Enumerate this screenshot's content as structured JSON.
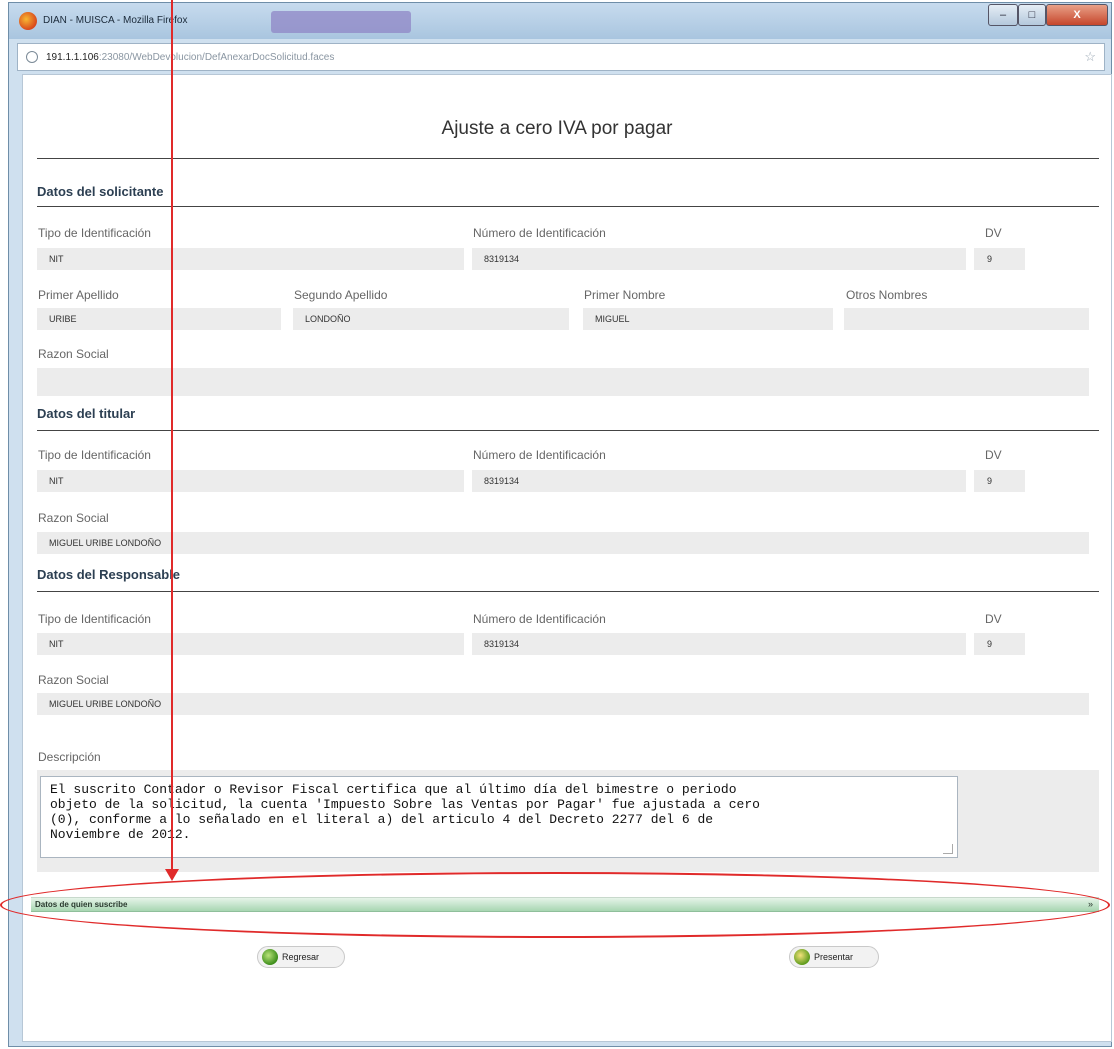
{
  "window": {
    "title": "DIAN - MUISCA - Mozilla Firefox",
    "url_host": "191.1.1.106",
    "url_rest": ":23080/WebDevolucion/DefAnexarDocSolicitud.faces",
    "controls": {
      "minimize": "–",
      "maximize": "□",
      "close": "X"
    }
  },
  "page": {
    "title": "Ajuste a cero IVA por pagar"
  },
  "solicitante": {
    "heading": "Datos del solicitante",
    "tipo_label": "Tipo de Identificación",
    "tipo_value": "NIT",
    "numero_label": "Número de Identificación",
    "numero_value": "8319134",
    "dv_label": "DV",
    "dv_value": "9",
    "primer_apellido_label": "Primer Apellido",
    "primer_apellido_value": "URIBE",
    "segundo_apellido_label": "Segundo Apellido",
    "segundo_apellido_value": "LONDOÑO",
    "primer_nombre_label": "Primer Nombre",
    "primer_nombre_value": "MIGUEL",
    "otros_nombres_label": "Otros Nombres",
    "otros_nombres_value": "",
    "razon_label": "Razon Social",
    "razon_value": ""
  },
  "titular": {
    "heading": "Datos del titular",
    "tipo_label": "Tipo de Identificación",
    "tipo_value": "NIT",
    "numero_label": "Número de Identificación",
    "numero_value": "8319134",
    "dv_label": "DV",
    "dv_value": "9",
    "razon_label": "Razon Social",
    "razon_value": "MIGUEL URIBE LONDOÑO"
  },
  "responsable": {
    "heading": "Datos del Responsable",
    "tipo_label": "Tipo de Identificación",
    "tipo_value": "NIT",
    "numero_label": "Número de Identificación",
    "numero_value": "8319134",
    "dv_label": "DV",
    "dv_value": "9",
    "razon_label": "Razon Social",
    "razon_value": "MIGUEL URIBE LONDOÑO"
  },
  "descripcion": {
    "label": "Descripción",
    "text": "El suscrito Contador o Revisor Fiscal certifica que al último día del bimestre o periodo\nobjeto de la solicitud, la cuenta 'Impuesto Sobre las Ventas por Pagar' fue ajustada a cero\n(0), conforme a lo señalado en el literal a) del articulo 4 del Decreto 2277 del 6 de\nNoviembre de 2012."
  },
  "suscribe": {
    "label": "Datos de quien suscribe",
    "toggle": "»"
  },
  "buttons": {
    "back": "Regresar",
    "present": "Presentar"
  },
  "annotation": {
    "color": "#e02a2a"
  }
}
